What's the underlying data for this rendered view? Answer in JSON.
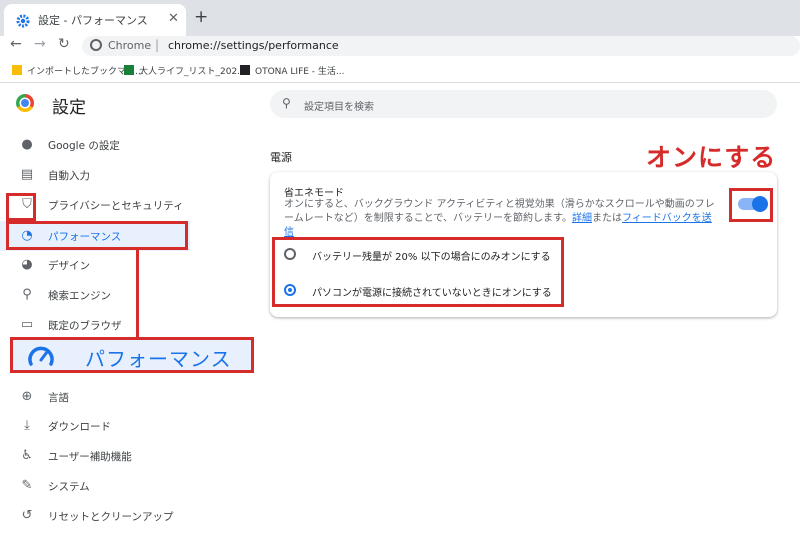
{
  "browser": {
    "tab_title": "設定 - パフォーマンス",
    "tab_close": "✕",
    "new_tab": "+",
    "back": "←",
    "forward": "→",
    "reload": "↻",
    "site_label": "Chrome",
    "url": "chrome://settings/performance",
    "bookmarks": [
      {
        "label": "インポートしたブックマー...",
        "icon": "folder-icon",
        "color": "#fbbc05"
      },
      {
        "label": "大人ライフ_リスト_202...",
        "icon": "sheets-icon",
        "color": "#188038"
      },
      {
        "label": "OTONA LIFE - 生活...",
        "icon": "otona-logo-icon",
        "color": "#202124"
      }
    ]
  },
  "header": {
    "title": "設定",
    "search_placeholder": "設定項目を検索"
  },
  "sidebar": {
    "items": [
      {
        "label": "Google の設定",
        "icon": "person-icon",
        "glyph": "●"
      },
      {
        "label": "自動入力",
        "icon": "clipboard-icon",
        "glyph": "▤"
      },
      {
        "label": "プライバシーとセキュリティ",
        "icon": "shield-icon",
        "glyph": "⛉"
      },
      {
        "label": "パフォーマンス",
        "icon": "speedometer-icon",
        "glyph": "◔"
      },
      {
        "label": "デザイン",
        "icon": "palette-icon",
        "glyph": "◕"
      },
      {
        "label": "検索エンジン",
        "icon": "search-icon",
        "glyph": "⚲"
      },
      {
        "label": "既定のブラウザ",
        "icon": "browser-icon",
        "glyph": "▭"
      },
      {
        "label": "言語",
        "icon": "globe-icon",
        "glyph": "⊕"
      },
      {
        "label": "ダウンロード",
        "icon": "download-icon",
        "glyph": "⤓"
      },
      {
        "label": "ユーザー補助機能",
        "icon": "accessibility-icon",
        "glyph": "♿"
      },
      {
        "label": "システム",
        "icon": "wrench-icon",
        "glyph": "✎"
      },
      {
        "label": "リセットとクリーンアップ",
        "icon": "reset-icon",
        "glyph": "↺"
      }
    ],
    "active_index": 3,
    "callout_label": "パフォーマンス"
  },
  "main": {
    "section_title": "電源",
    "annotation": "オンにする",
    "energy_saver": {
      "title": "省エネモード",
      "description": "オンにすると、バックグラウンド アクティビティと視覚効果（滑らかなスクロールや動画のフレームレートなど）を制限することで、バッテリーを節約します。",
      "link_details": "詳細",
      "link_joiner": "または",
      "link_feedback": "フィードバックを送信",
      "enabled": true
    },
    "options": [
      {
        "label": "バッテリー残量が 20% 以下の場合にのみオンにする",
        "selected": false
      },
      {
        "label": "パソコンが電源に接続されていないときにオンにする",
        "selected": true
      }
    ]
  },
  "colors": {
    "accent": "#1a73e8",
    "annotation_red": "#d52b2b"
  }
}
